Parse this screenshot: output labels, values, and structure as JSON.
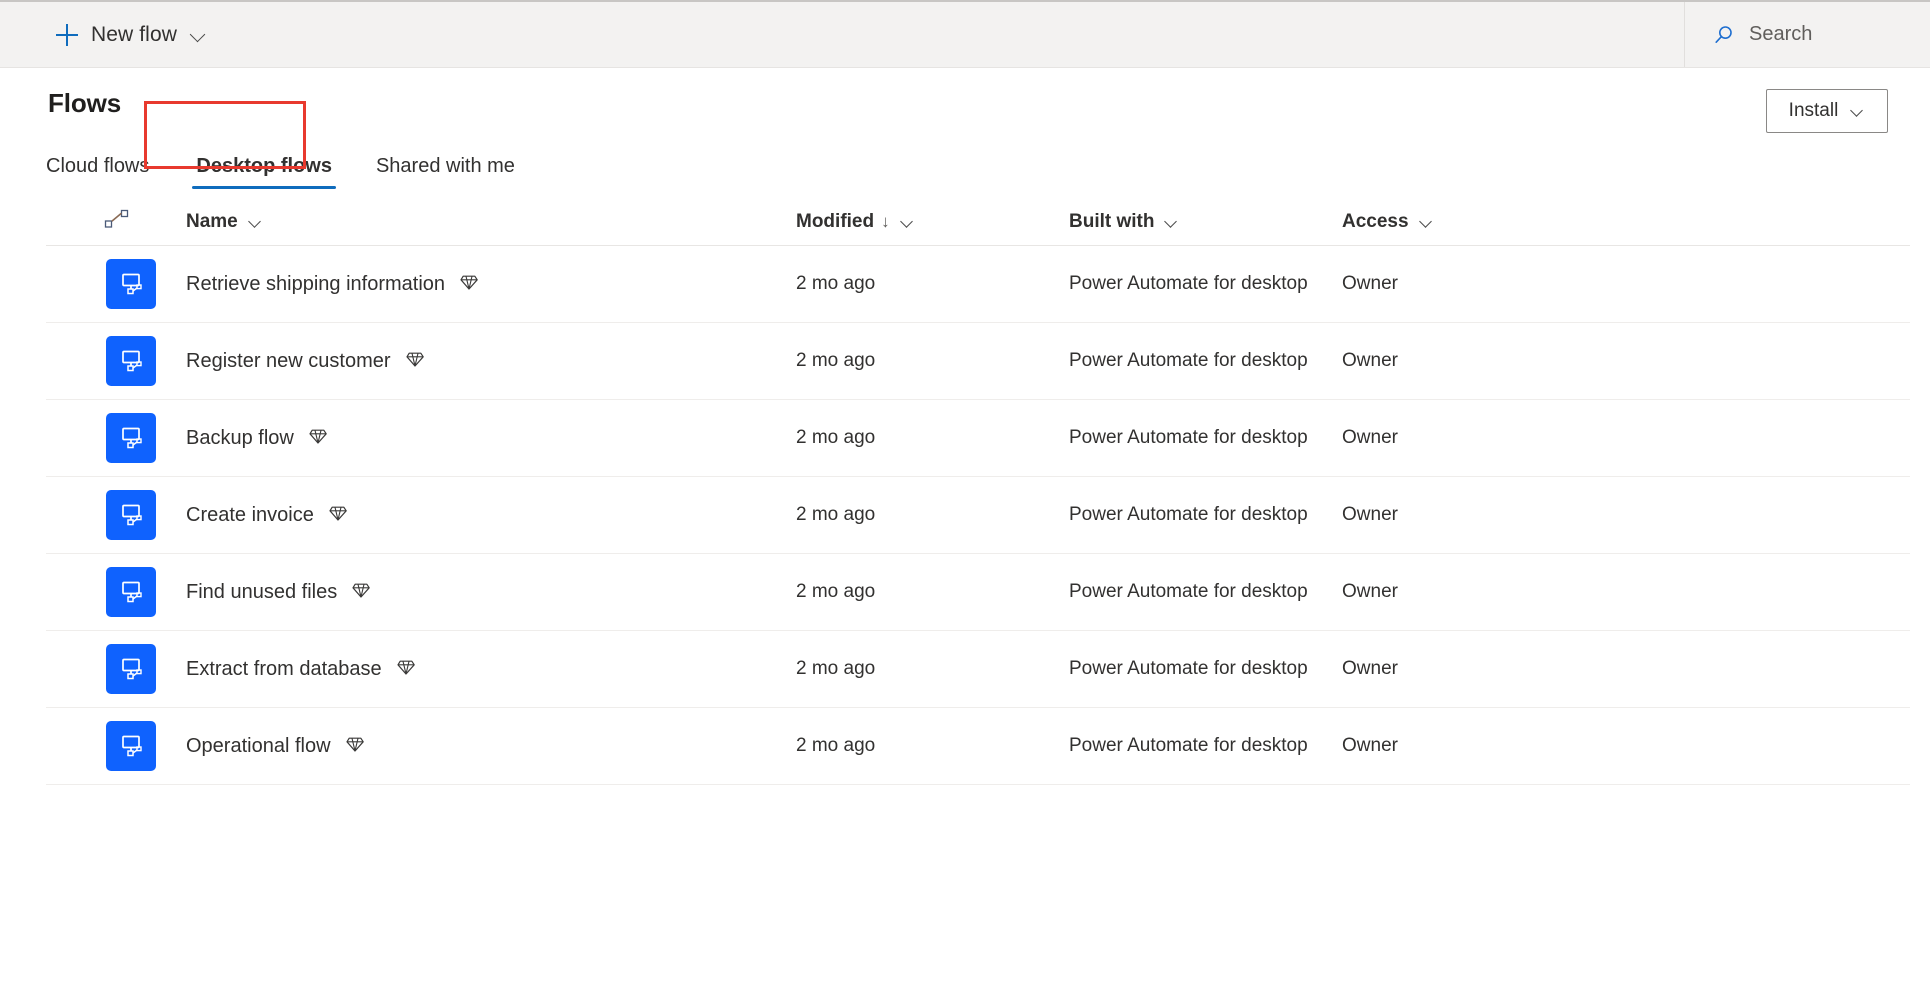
{
  "toolbar": {
    "new_flow_label": "New flow",
    "new_flow_icon": "plus-icon",
    "new_flow_chevron": "chevron-down-icon",
    "search_placeholder": "Search",
    "search_icon": "search-icon"
  },
  "header": {
    "title": "Flows",
    "install_label": "Install",
    "install_chevron": "chevron-down-icon"
  },
  "tabs": [
    {
      "label": "Cloud flows",
      "active": false,
      "highlighted": false
    },
    {
      "label": "Desktop flows",
      "active": true,
      "highlighted": true
    },
    {
      "label": "Shared with me",
      "active": false,
      "highlighted": false
    }
  ],
  "highlight": {
    "color": "#e8392e",
    "target_tab": "Desktop flows"
  },
  "colors": {
    "accent": "#0f6cbd",
    "tile_blue": "#0f62fe",
    "toolbar_bg": "#f3f2f1",
    "highlight_red": "#e8392e",
    "row_divider": "#efedeb"
  },
  "table": {
    "columns": [
      {
        "key": "icon",
        "label": "",
        "icon": "flow-connector-icon",
        "sortable": true,
        "sorted": false
      },
      {
        "key": "name",
        "label": "Name",
        "icon": "chevron-down-icon",
        "sortable": true,
        "sorted": false
      },
      {
        "key": "mod",
        "label": "Modified",
        "icon": "chevron-down-icon",
        "sortable": true,
        "sorted": true,
        "sort_arrow": "↓"
      },
      {
        "key": "built",
        "label": "Built with",
        "icon": "chevron-down-icon",
        "sortable": true,
        "sorted": false
      },
      {
        "key": "access",
        "label": "Access",
        "icon": "chevron-down-icon",
        "sortable": true,
        "sorted": false
      }
    ],
    "rows": [
      {
        "name": "Retrieve shipping information",
        "premium": true,
        "modified": "2 mo ago",
        "built_with": "Power Automate for desktop",
        "access": "Owner"
      },
      {
        "name": "Register new customer",
        "premium": true,
        "modified": "2 mo ago",
        "built_with": "Power Automate for desktop",
        "access": "Owner"
      },
      {
        "name": "Backup flow",
        "premium": true,
        "modified": "2 mo ago",
        "built_with": "Power Automate for desktop",
        "access": "Owner"
      },
      {
        "name": "Create invoice",
        "premium": true,
        "modified": "2 mo ago",
        "built_with": "Power Automate for desktop",
        "access": "Owner"
      },
      {
        "name": "Find unused files",
        "premium": true,
        "modified": "2 mo ago",
        "built_with": "Power Automate for desktop",
        "access": "Owner"
      },
      {
        "name": "Extract from database",
        "premium": true,
        "modified": "2 mo ago",
        "built_with": "Power Automate for desktop",
        "access": "Owner"
      },
      {
        "name": "Operational flow",
        "premium": true,
        "modified": "2 mo ago",
        "built_with": "Power Automate for desktop",
        "access": "Owner"
      }
    ]
  }
}
